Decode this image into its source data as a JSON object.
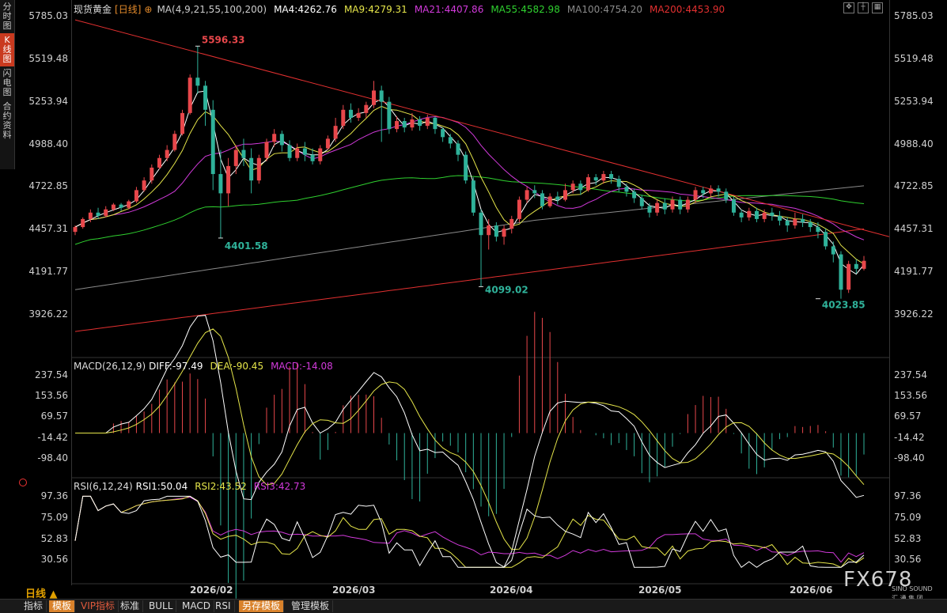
{
  "left_tabs": [
    {
      "label": "分时图",
      "active": false
    },
    {
      "label": "K线图",
      "active": true
    },
    {
      "label": "闪电图",
      "active": false
    },
    {
      "label": "合约资料",
      "active": false
    }
  ],
  "header": {
    "title": "现货黄金",
    "period": "[日线]",
    "ma_params": "MA(4,9,21,55,100,200)",
    "ma4": "MA4:4262.76",
    "ma9": "MA9:4279.31",
    "ma21": "MA21:4407.86",
    "ma55": "MA55:4582.98",
    "ma100": "MA100:4754.20",
    "ma200": "MA200:4453.90"
  },
  "macd_header": {
    "label": "MACD(26,12,9)",
    "diff": "DIFF:-97.49",
    "dea": "DEA:-90.45",
    "macd": "MACD:-14.08"
  },
  "rsi_header": {
    "label": "RSI(6,12,24)",
    "rsi1": "RSI1:50.04",
    "rsi2": "RSI2:43.52",
    "rsi3": "RSI3:42.73"
  },
  "price_ticks": [
    "5785.03",
    "5519.48",
    "5253.94",
    "4988.40",
    "4722.85",
    "4457.31",
    "4191.77",
    "3926.22"
  ],
  "macd_ticks": [
    "237.54",
    "153.56",
    "69.57",
    "-14.42",
    "-98.40"
  ],
  "rsi_ticks": [
    "97.36",
    "75.09",
    "52.83",
    "30.56"
  ],
  "x_labels": [
    "2026/02",
    "2026/03",
    "2026/04",
    "2026/05",
    "2026/06"
  ],
  "annotations": {
    "high": "5596.33",
    "low1": "4401.58",
    "low2": "4099.02",
    "low3": "4023.85"
  },
  "period_label": "日线 ▲",
  "bottom_tabs": [
    "指标",
    "模板",
    "VIP指标",
    "标准",
    "BULL",
    "MACD",
    "RSI",
    "另存模板",
    "管理模板"
  ],
  "watermark": {
    "main": "FX678",
    "sub1": "SINO SOUND",
    "sub2": "汇 通 集 团"
  },
  "colors": {
    "up": "#e8474b",
    "down": "#2fb29a",
    "ma4": "#ffffff",
    "ma9": "#e6e64a",
    "ma21": "#d23adb",
    "ma55": "#2fd02f",
    "ma100": "#8a8a8a",
    "ma200": "#e23030",
    "trend": "#e23030"
  },
  "chart_data": [
    {
      "type": "candlestick",
      "title": "现货黄金 日线",
      "ylim": [
        3926.22,
        5785.03
      ],
      "x": [
        "2026/02",
        "2026/03",
        "2026/04",
        "2026/05",
        "2026/06"
      ],
      "annotations": [
        {
          "label": "5596.33",
          "value": 5596.33
        },
        {
          "label": "4401.58",
          "value": 4401.58
        },
        {
          "label": "4099.02",
          "value": 4099.02
        },
        {
          "label": "4023.85",
          "value": 4023.85
        }
      ],
      "series": [
        {
          "name": "MA4",
          "last": 4262.76
        },
        {
          "name": "MA9",
          "last": 4279.31
        },
        {
          "name": "MA21",
          "last": 4407.86
        },
        {
          "name": "MA55",
          "last": 4582.98
        },
        {
          "name": "MA100",
          "last": 4754.2
        },
        {
          "name": "MA200",
          "last": 4453.9
        }
      ],
      "candles": [
        [
          4440,
          4470,
          4420,
          4480
        ],
        [
          4470,
          4520,
          4460,
          4530
        ],
        [
          4520,
          4560,
          4500,
          4580
        ],
        [
          4560,
          4540,
          4520,
          4590
        ],
        [
          4540,
          4580,
          4530,
          4600
        ],
        [
          4580,
          4610,
          4570,
          4620
        ],
        [
          4610,
          4590,
          4570,
          4620
        ],
        [
          4590,
          4630,
          4580,
          4640
        ],
        [
          4630,
          4700,
          4620,
          4720
        ],
        [
          4700,
          4760,
          4690,
          4780
        ],
        [
          4760,
          4840,
          4740,
          4860
        ],
        [
          4840,
          4900,
          4830,
          4920
        ],
        [
          4900,
          4950,
          4880,
          4980
        ],
        [
          4950,
          5050,
          4940,
          5070
        ],
        [
          5050,
          5180,
          5040,
          5200
        ],
        [
          5180,
          5400,
          5170,
          5420
        ],
        [
          5400,
          5350,
          5300,
          5596.33
        ],
        [
          5350,
          5200,
          5100,
          5380
        ],
        [
          5200,
          4800,
          4700,
          5260
        ],
        [
          4800,
          4680,
          4401.58,
          4950
        ],
        [
          4680,
          4850,
          4600,
          4900
        ],
        [
          4850,
          4950,
          4800,
          4980
        ],
        [
          4950,
          4900,
          4850,
          5020
        ],
        [
          4900,
          4760,
          4680,
          4960
        ],
        [
          4760,
          4900,
          4740,
          4920
        ],
        [
          4900,
          5000,
          4880,
          5020
        ],
        [
          5000,
          5050,
          4970,
          5080
        ],
        [
          5050,
          4980,
          4940,
          5070
        ],
        [
          4980,
          4900,
          4880,
          5010
        ],
        [
          4900,
          4960,
          4880,
          4990
        ],
        [
          4960,
          4920,
          4880,
          5000
        ],
        [
          4920,
          4880,
          4860,
          4960
        ],
        [
          4880,
          4960,
          4860,
          4980
        ],
        [
          4960,
          5020,
          4950,
          5040
        ],
        [
          5020,
          5100,
          5000,
          5150
        ],
        [
          5100,
          5200,
          5080,
          5230
        ],
        [
          5200,
          5150,
          5120,
          5240
        ],
        [
          5150,
          5180,
          5130,
          5210
        ],
        [
          5180,
          5230,
          5150,
          5250
        ],
        [
          5230,
          5320,
          5210,
          5380
        ],
        [
          5320,
          5250,
          5000,
          5350
        ],
        [
          5250,
          5080,
          5050,
          5280
        ],
        [
          5080,
          5130,
          5060,
          5160
        ],
        [
          5130,
          5090,
          5060,
          5150
        ],
        [
          5090,
          5140,
          5070,
          5180
        ],
        [
          5140,
          5100,
          5070,
          5160
        ],
        [
          5100,
          5150,
          5080,
          5170
        ],
        [
          5150,
          5080,
          5050,
          5160
        ],
        [
          5080,
          5030,
          5000,
          5090
        ],
        [
          5030,
          4990,
          4960,
          5050
        ],
        [
          4990,
          4920,
          4880,
          5010
        ],
        [
          4920,
          4760,
          4740,
          4940
        ],
        [
          4760,
          4560,
          4540,
          4780
        ],
        [
          4560,
          4420,
          4099.02,
          4580
        ],
        [
          4420,
          4480,
          4330,
          4520
        ],
        [
          4480,
          4410,
          4380,
          4500
        ],
        [
          4410,
          4460,
          4360,
          4480
        ],
        [
          4460,
          4520,
          4430,
          4540
        ],
        [
          4520,
          4640,
          4500,
          4660
        ],
        [
          4640,
          4700,
          4620,
          4720
        ],
        [
          4700,
          4680,
          4650,
          4730
        ],
        [
          4680,
          4600,
          4580,
          4700
        ],
        [
          4600,
          4660,
          4590,
          4680
        ],
        [
          4660,
          4640,
          4610,
          4690
        ],
        [
          4640,
          4700,
          4630,
          4740
        ],
        [
          4700,
          4740,
          4680,
          4760
        ],
        [
          4740,
          4700,
          4670,
          4760
        ],
        [
          4700,
          4780,
          4690,
          4800
        ],
        [
          4780,
          4760,
          4730,
          4800
        ],
        [
          4760,
          4800,
          4740,
          4820
        ],
        [
          4800,
          4770,
          4740,
          4820
        ],
        [
          4770,
          4720,
          4690,
          4790
        ],
        [
          4720,
          4690,
          4660,
          4740
        ],
        [
          4690,
          4650,
          4620,
          4710
        ],
        [
          4650,
          4600,
          4580,
          4670
        ],
        [
          4600,
          4560,
          4530,
          4620
        ],
        [
          4560,
          4620,
          4540,
          4640
        ],
        [
          4620,
          4580,
          4550,
          4650
        ],
        [
          4580,
          4640,
          4560,
          4660
        ],
        [
          4640,
          4580,
          4550,
          4660
        ],
        [
          4580,
          4640,
          4560,
          4660
        ],
        [
          4640,
          4700,
          4620,
          4720
        ],
        [
          4700,
          4680,
          4650,
          4720
        ],
        [
          4680,
          4710,
          4660,
          4730
        ],
        [
          4710,
          4690,
          4660,
          4730
        ],
        [
          4690,
          4640,
          4620,
          4710
        ],
        [
          4640,
          4560,
          4540,
          4660
        ],
        [
          4560,
          4530,
          4500,
          4580
        ],
        [
          4530,
          4570,
          4510,
          4590
        ],
        [
          4570,
          4520,
          4500,
          4590
        ],
        [
          4520,
          4560,
          4500,
          4580
        ],
        [
          4560,
          4540,
          4510,
          4590
        ],
        [
          4540,
          4510,
          4480,
          4570
        ],
        [
          4510,
          4480,
          4440,
          4530
        ],
        [
          4480,
          4520,
          4460,
          4560
        ],
        [
          4520,
          4500,
          4470,
          4550
        ],
        [
          4500,
          4470,
          4440,
          4520
        ],
        [
          4470,
          4440,
          4400,
          4500
        ],
        [
          4440,
          4350,
          4330,
          4460
        ],
        [
          4350,
          4300,
          4250,
          4380
        ],
        [
          4300,
          4080,
          4023.85,
          4320
        ],
        [
          4080,
          4240,
          4060,
          4260
        ],
        [
          4240,
          4210,
          4180,
          4270
        ],
        [
          4210,
          4260,
          4200,
          4290
        ]
      ]
    },
    {
      "type": "line",
      "title": "MACD(26,12,9)",
      "ylim": [
        -140,
        240
      ],
      "series": [
        {
          "name": "DIFF",
          "last": -97.49
        },
        {
          "name": "DEA",
          "last": -90.45
        },
        {
          "name": "MACD",
          "last": -14.08
        }
      ]
    },
    {
      "type": "line",
      "title": "RSI(6,12,24)",
      "ylim": [
        20,
        100
      ],
      "series": [
        {
          "name": "RSI1",
          "last": 50.04
        },
        {
          "name": "RSI2",
          "last": 43.52
        },
        {
          "name": "RSI3",
          "last": 42.73
        }
      ]
    }
  ]
}
